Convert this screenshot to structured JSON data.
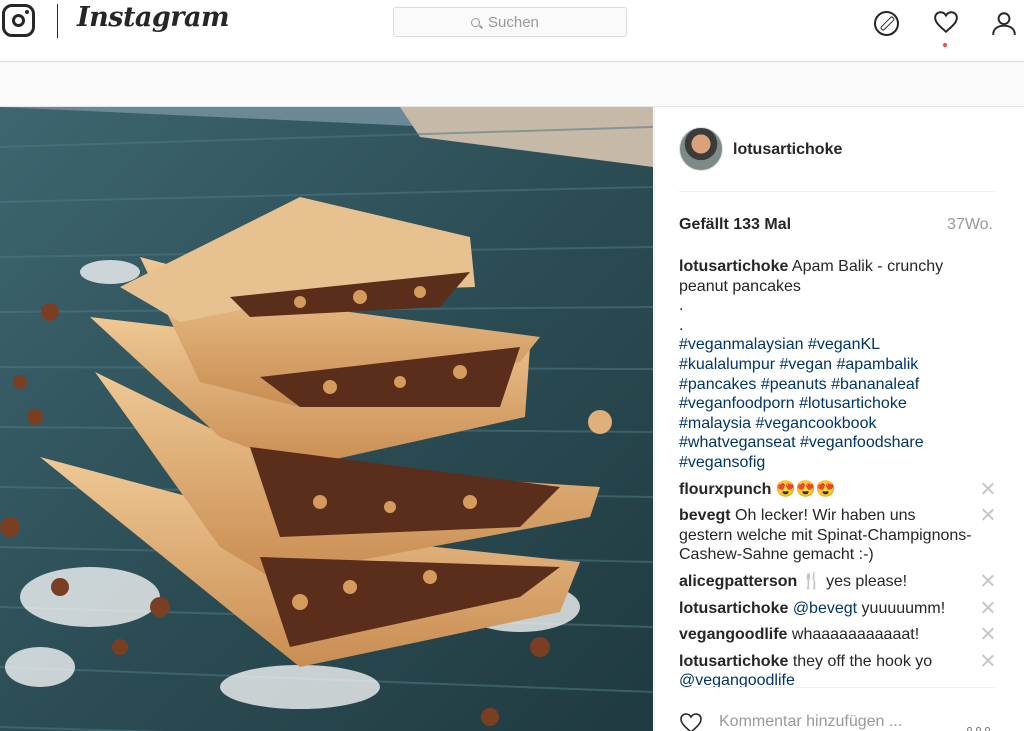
{
  "nav": {
    "brand": "Instagram",
    "search_placeholder": "Suchen",
    "icons": [
      "instagram-logo-icon",
      "compass-icon",
      "heart-icon",
      "profile-icon"
    ]
  },
  "post": {
    "author": "lotusartichoke",
    "likes_text": "Gefällt 133 Mal",
    "age": "37Wo.",
    "caption": {
      "user": "lotusartichoke",
      "text": "Apam Balik - crunchy peanut pancakes",
      "dot1": ".",
      "dot2": ".",
      "hashtags": "#veganmalaysian #veganKL #kualalumpur #vegan #apambalik #pancakes #peanuts #bananaleaf #veganfoodporn #lotusartichoke #malaysia #vegancookbook #whatveganseat #veganfoodshare #vegansofig"
    },
    "comments": [
      {
        "user": "flourxpunch",
        "text": "😍😍😍"
      },
      {
        "user": "bevegt",
        "text": "Oh lecker! Wir haben uns gestern welche mit Spinat-Champignons-Cashew-Sahne gemacht :-)"
      },
      {
        "user": "alicegpatterson",
        "text": "🍴 yes please!"
      },
      {
        "user": "lotusartichoke",
        "mention": "@bevegt",
        "text": " yuuuuumm!"
      },
      {
        "user": "vegangoodlife",
        "text": "whaaaaaaaaaaat!"
      },
      {
        "user": "lotusartichoke",
        "text": "they off the hook yo",
        "mention_cut": "@vegangoodlife"
      }
    ],
    "comment_placeholder": "Kommentar hinzufügen ..."
  },
  "colors": {
    "accent": "#003569",
    "notification": "#ed4956",
    "leaf": "#2d4d54",
    "pancake": "#d9a56b"
  }
}
